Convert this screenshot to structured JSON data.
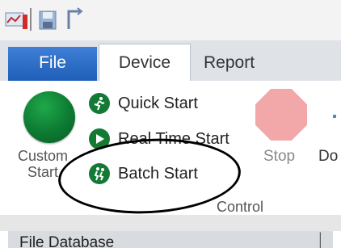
{
  "quick_access": {
    "icons": [
      "chart-icon",
      "save-icon",
      "undo-icon"
    ]
  },
  "tabs": [
    {
      "label": "File",
      "active": false
    },
    {
      "label": "Device",
      "active": true
    },
    {
      "label": "Report",
      "active": false
    }
  ],
  "ribbon": {
    "custom_start": {
      "label_line1": "Custom",
      "label_line2": "Start"
    },
    "commands": [
      {
        "label": "Quick Start",
        "icon": "runner-icon"
      },
      {
        "label": "Real Time Start",
        "icon": "play-icon"
      },
      {
        "label": "Batch Start",
        "icon": "batch-runner-icon"
      }
    ],
    "stop_label": "Stop",
    "do_label": "Do",
    "group_label": "Control"
  },
  "panel": {
    "title": "File Database"
  },
  "colors": {
    "file_tab": "#1f5fb8",
    "start_green": "#0d7a32",
    "stop_red": "#f2a7a8"
  }
}
